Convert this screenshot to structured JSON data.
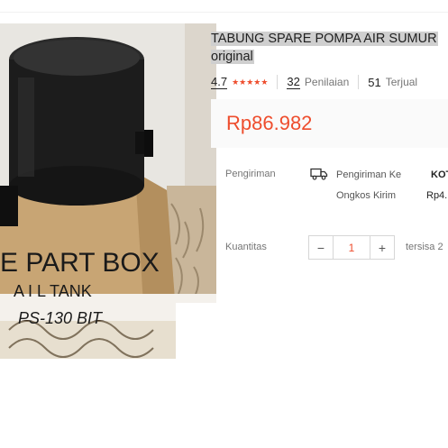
{
  "product": {
    "title_line1": "TABUNG SPARE POMPA AIR SUMUR",
    "title_line2": "original",
    "rating": "4.7",
    "stars": "★★★★★",
    "reviews_count": "32",
    "reviews_label": "Penilaian",
    "sold_count": "51",
    "sold_label": "Terjual",
    "price": "Rp86.982"
  },
  "image_text": {
    "line1": "E PART BOX",
    "line2": "A I L TANK",
    "line3": "PS-130 BIT"
  },
  "shipping": {
    "label": "Pengiriman",
    "to_label": "Pengiriman Ke",
    "to_value": "KOT",
    "cost_label": "Ongkos Kirim",
    "cost_value": "Rp4."
  },
  "quantity": {
    "label": "Kuantitas",
    "minus": "−",
    "value": "1",
    "plus": "+",
    "stock": "tersisa 2"
  },
  "colors": {
    "accent": "#ee4d2d",
    "title_highlight": "#cfcfcf"
  }
}
